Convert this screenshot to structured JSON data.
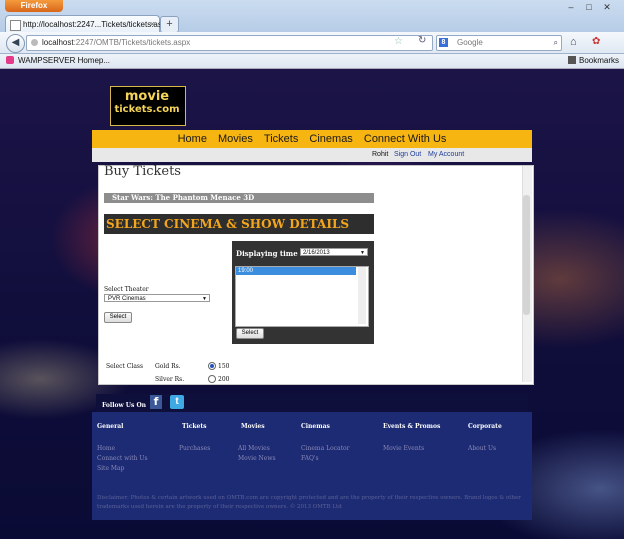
{
  "browser": {
    "app_button": "Firefox",
    "tab_title": "http://localhost:2247...Tickets/tickets.aspx",
    "url_host": "localhost",
    "url_path": ":2247/OMTB/Tickets/tickets.aspx",
    "search_placeholder": "Google",
    "bookmark_1": "WAMPSERVER Homep...",
    "bookmarks_menu": "Bookmarks"
  },
  "logo": {
    "line1": "movie",
    "line2": "tickets.com"
  },
  "nav": {
    "items": [
      "Home",
      "Movies",
      "Tickets",
      "Cinemas",
      "Connect With Us"
    ],
    "user": "Rohit",
    "sign_out": "Sign Out",
    "my_account": "My Account"
  },
  "page": {
    "heading": "Buy Tickets",
    "movie_title": "Star Wars: The Phantom Menace 3D",
    "section_title": "SELECT CINEMA & SHOW DETAILS",
    "theater_label": "Select Theater",
    "theater_value": "PVR Cinemas",
    "select_button": "Select",
    "time_label": "Displaying time for",
    "date_value": "2/16/2013",
    "times": [
      "19:00"
    ],
    "time_select_button": "Select",
    "class_label": "Select Class",
    "classes": [
      {
        "name": "Gold Rs.",
        "price": "150",
        "selected": true
      },
      {
        "name": "Silver Rs.",
        "price": "200",
        "selected": false
      }
    ]
  },
  "footer": {
    "follow_label": "Follow Us On",
    "columns": [
      {
        "heading": "General",
        "links": [
          "Home",
          "Connect with Us",
          "Site Map"
        ]
      },
      {
        "heading": "Tickets",
        "links": [
          "Purchases"
        ]
      },
      {
        "heading": "Movies",
        "links": [
          "All Movies",
          "Movie News"
        ]
      },
      {
        "heading": "Cinemas",
        "links": [
          "Cinema Locator",
          "FAQ's"
        ]
      },
      {
        "heading": "Events & Promos",
        "links": [
          "Movie Events"
        ]
      },
      {
        "heading": "Corporate",
        "links": [
          "About Us"
        ]
      }
    ],
    "disclaimer": "Disclaimer: Photos & certain artwork used on OMTB.com are copyright protected and are the property of their respective owners. Brand logos & other trademarks used herein are the property of their respective owners. © 2013 OMTB Ltd"
  },
  "colors": {
    "nav_accent": "#f7b512",
    "section_title": "#f3a51c",
    "footer_bg": "#1c2b73"
  }
}
